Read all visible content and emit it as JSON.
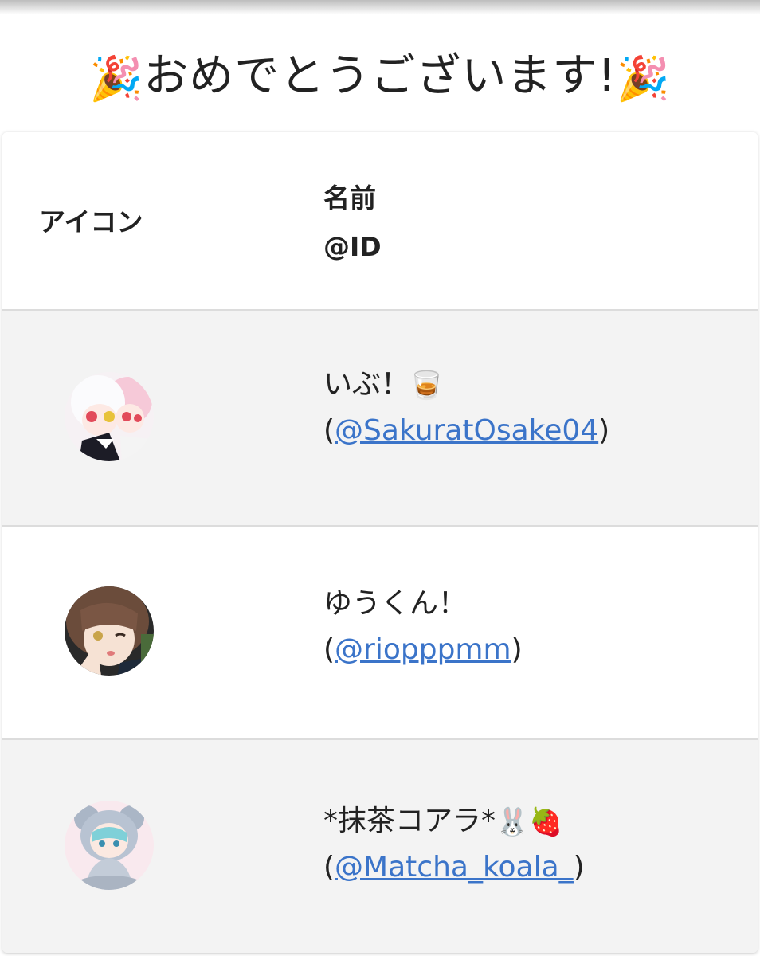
{
  "title": {
    "left_emoji": "🎉",
    "text": "おめでとうございます!",
    "right_emoji": "🎉"
  },
  "table": {
    "headers": {
      "icon": "アイコン",
      "name": "名前",
      "id": "@ID"
    },
    "rows": [
      {
        "avatar": "avatar-image-twins-white-pink-hair",
        "name": "いぶ！",
        "name_emoji": "🥃",
        "open_paren": "(",
        "handle": "@SakuratOsake04",
        "close_paren": ")"
      },
      {
        "avatar": "avatar-image-brown-hair-wink",
        "name": "ゆうくん！",
        "name_emoji": "",
        "open_paren": "(",
        "handle": "@riopppmm",
        "close_paren": ")"
      },
      {
        "avatar": "avatar-image-koala-hood-girl",
        "name": "*抹茶コアラ*",
        "name_emoji": "🐰🍓",
        "open_paren": "(",
        "handle": "@Matcha_koala_",
        "close_paren": ")"
      }
    ]
  },
  "colors": {
    "link": "#3b74c9",
    "stripe": "#f3f3f3",
    "divider": "#dcdcdc",
    "text": "#222222"
  }
}
